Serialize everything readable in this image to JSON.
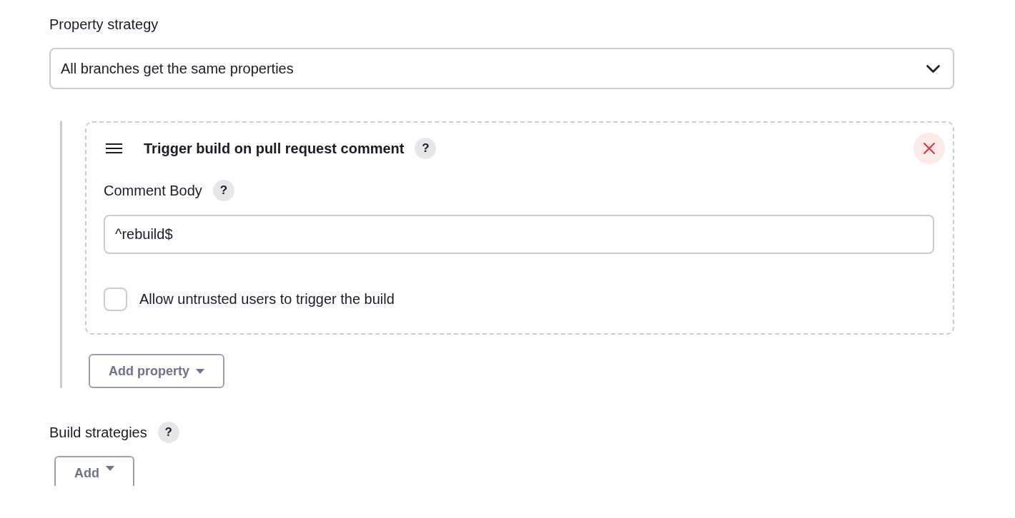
{
  "property_strategy": {
    "label": "Property strategy",
    "select": {
      "value": "All branches get the same properties"
    }
  },
  "properties": [
    {
      "title": "Trigger build on pull request comment",
      "help": "?",
      "fields": [
        {
          "kind": "text",
          "label": "Comment Body",
          "help": "?",
          "value": "^rebuild$"
        },
        {
          "kind": "checkbox",
          "label": "Allow untrusted users to trigger the build",
          "checked": false
        }
      ]
    }
  ],
  "add_property_button": {
    "label": "Add property"
  },
  "build_strategies": {
    "label": "Build strategies",
    "help": "?",
    "add_button": {
      "label": "Add"
    }
  }
}
